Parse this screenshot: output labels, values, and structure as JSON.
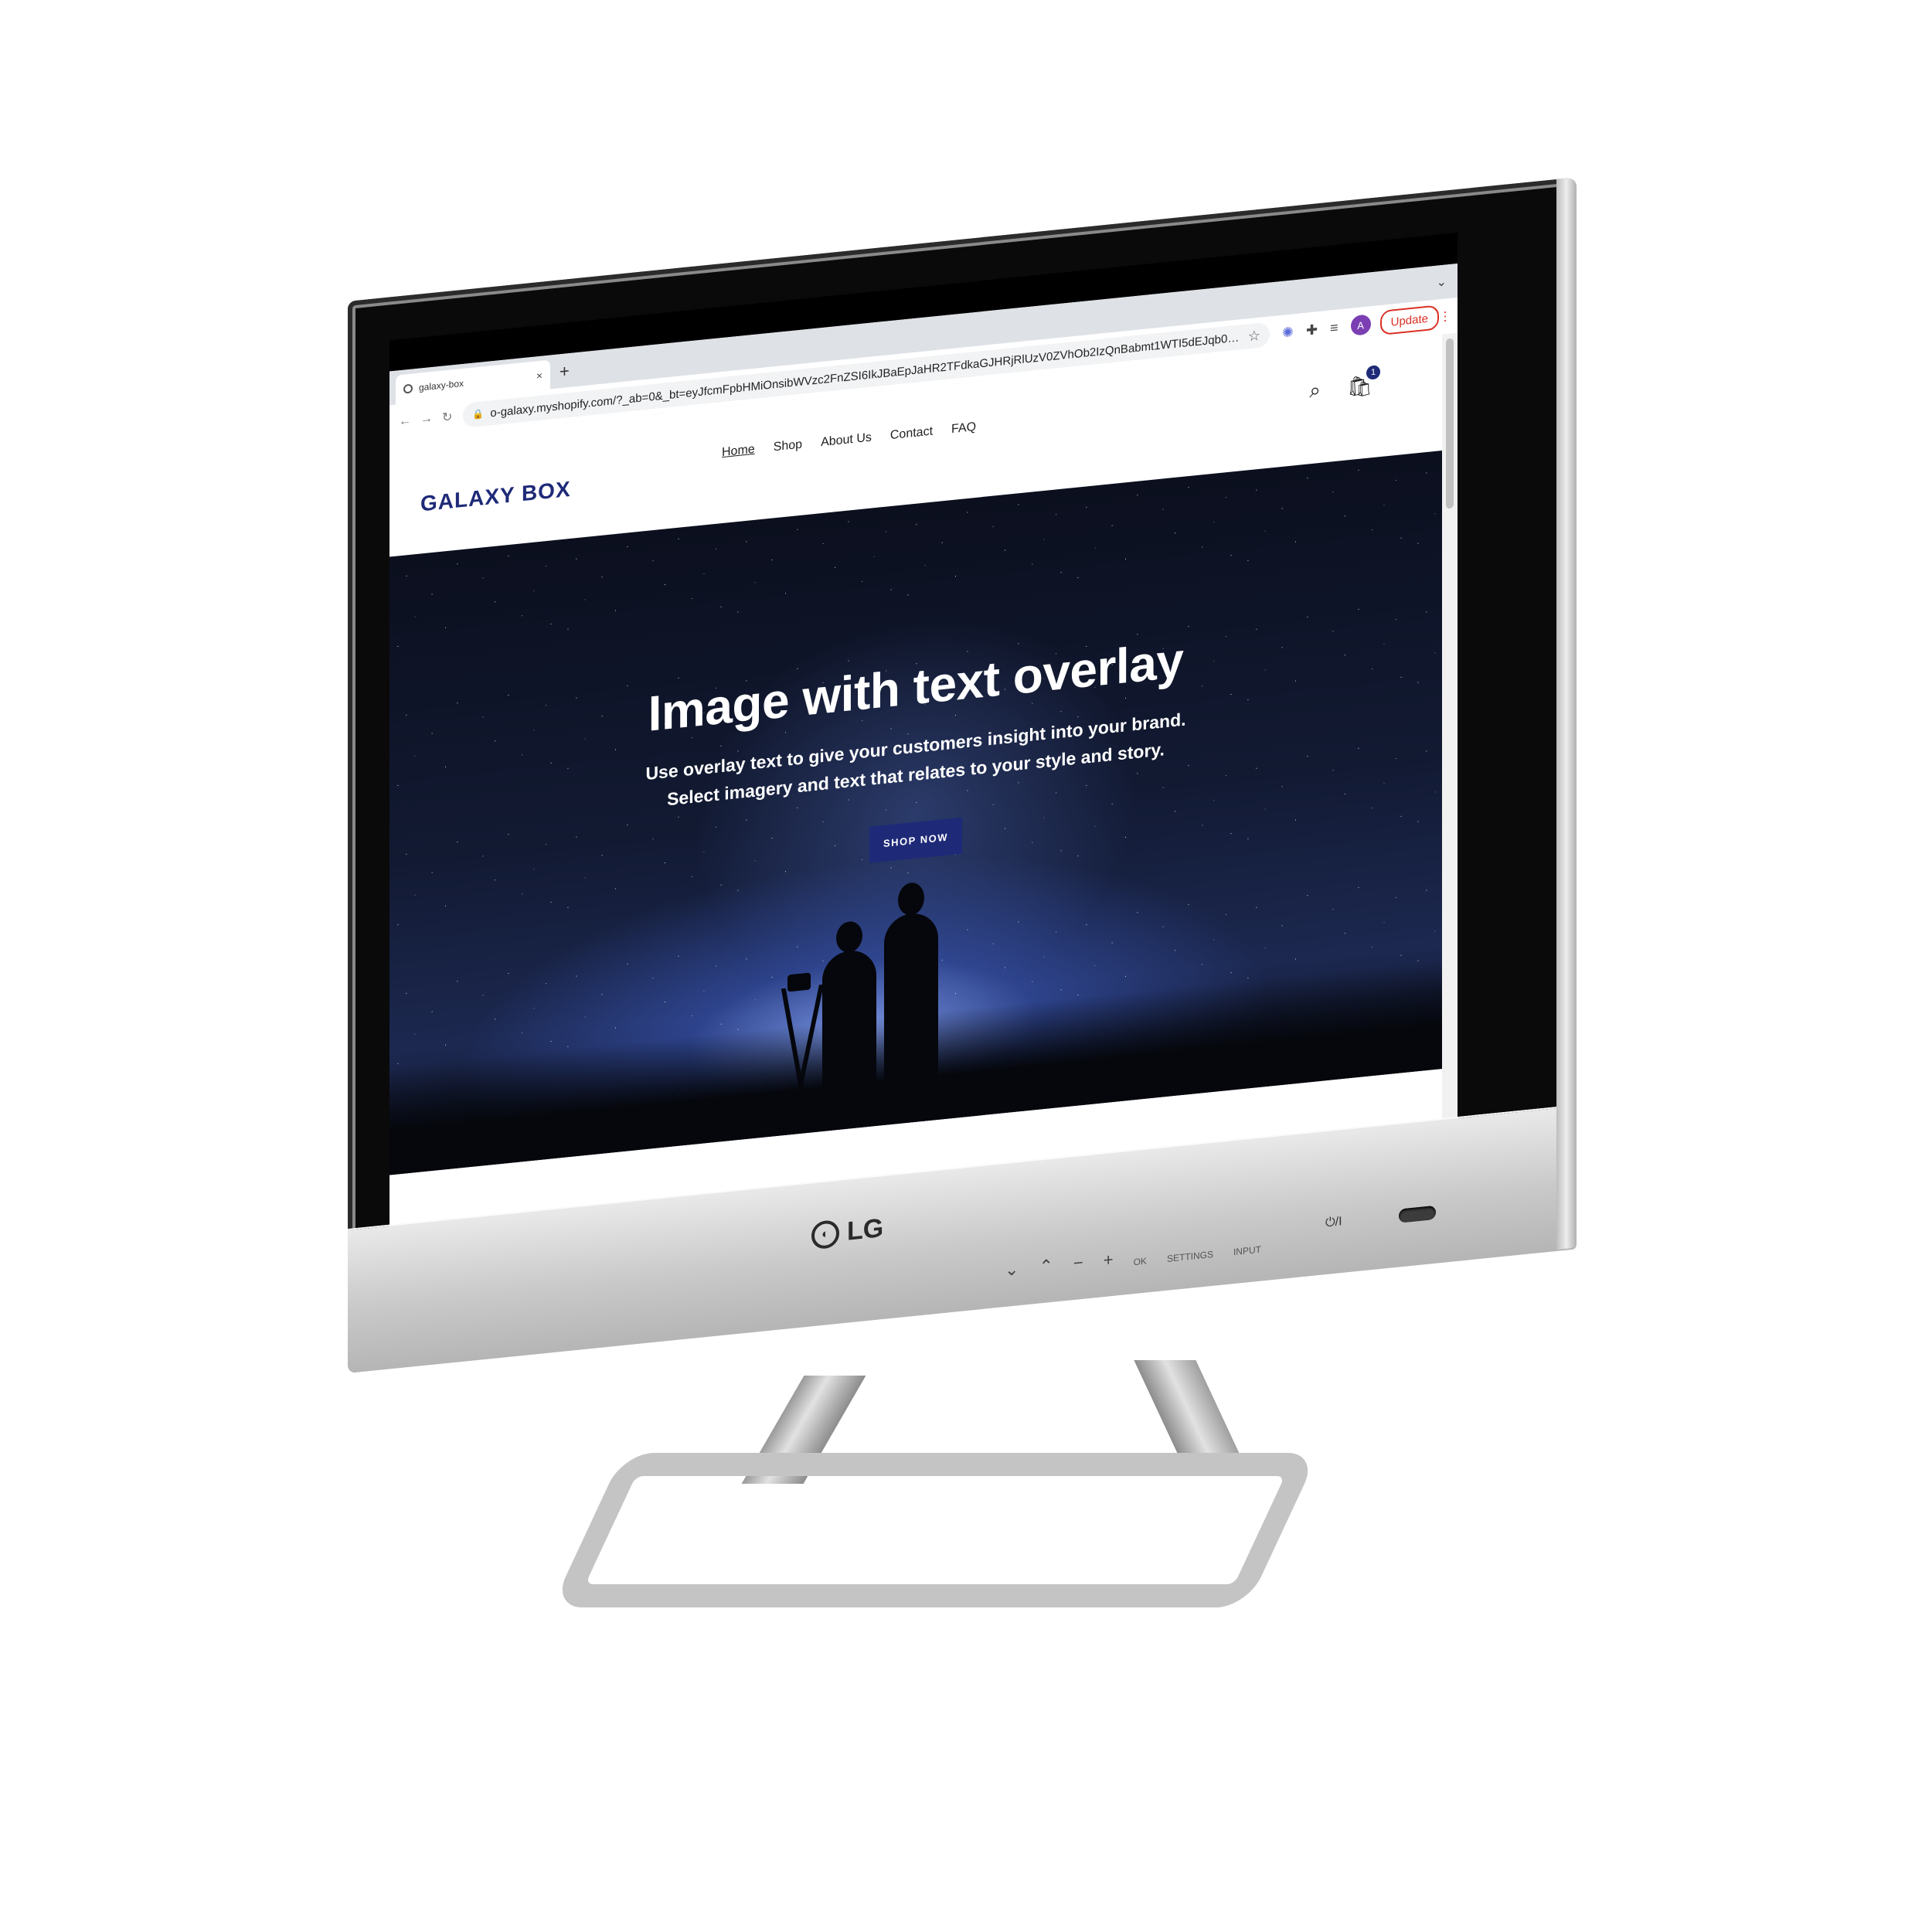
{
  "browser": {
    "tab_title": "galaxy-box",
    "new_tab_symbol": "+",
    "url": "o-galaxy.myshopify.com/?_ab=0&_bt=eyJfcmFpbHMiOnsibWVzc2FnZSI6IkJBaEpJaHR2TFdkaGJHRjRlUzV0ZVhOb2IzQnBabmt1WTI5dEJqb0dSVlE9IiwiZ...",
    "update_label": "Update",
    "avatar_initial": "A"
  },
  "site": {
    "brand": "GALAXY BOX",
    "nav": [
      "Home",
      "Shop",
      "About Us",
      "Contact",
      "FAQ"
    ],
    "cart_count": "1"
  },
  "hero": {
    "title": "Image with text overlay",
    "subtitle": "Use overlay text to give your customers insight into your brand. Select imagery and text that relates to your style and story.",
    "cta": "SHOP NOW"
  },
  "monitor": {
    "brand": "LG",
    "controls": [
      "OK",
      "SETTINGS",
      "INPUT"
    ],
    "power_label": "⏻/I"
  },
  "colors": {
    "accent": "#1e2a78",
    "update_red": "#d93025"
  },
  "icons": [
    "back-icon",
    "forward-icon",
    "reload-icon",
    "lock-icon",
    "star-icon",
    "extension-icon",
    "puzzle-icon",
    "media-icon",
    "search-icon",
    "cart-icon",
    "chevron-down-icon"
  ]
}
